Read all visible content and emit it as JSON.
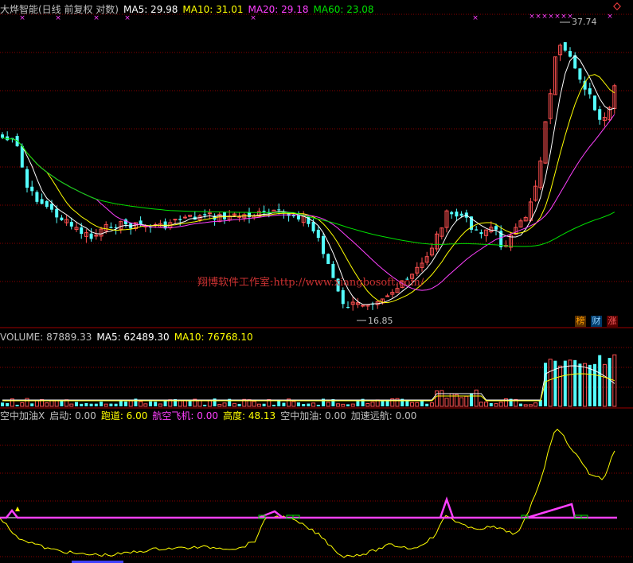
{
  "panel_main": {
    "name": "大烨智能(日线 前复权 对数)",
    "ma5": "MA5: 29.98",
    "ma10": "MA10: 31.01",
    "ma20": "MA20: 29.18",
    "ma60": "MA60: 23.08",
    "high_label": "37.74",
    "low_label": "16.85",
    "watermark": "翔博软件工作室:http://www.xiangbosoft.com/",
    "buttons": [
      "榜",
      "财",
      "涨"
    ]
  },
  "panel_volume": {
    "volume": "VOLUME: 87889.33",
    "ma5": "MA5: 62489.30",
    "ma10": "MA10: 76768.10"
  },
  "panel_indicator": {
    "name": "空中加油X",
    "start": "启动: 0.00",
    "runway": "跑道: 6.00",
    "airplane": "航空飞机: 0.00",
    "height": "高度: 48.13",
    "refuel": "空中加油: 0.00",
    "accel": "加速远航: 0.00"
  },
  "colors": {
    "up": "#ff5050",
    "down": "#54ffff",
    "ma5": "#ffffff",
    "ma10": "#ffff00",
    "ma20": "#ff40ff",
    "ma60": "#00e000",
    "grid": "#8b0000"
  },
  "chart_data": {
    "type": "candlestick",
    "price_high": 37.74,
    "price_low": 16.85,
    "current": {
      "ma5": 29.98,
      "ma10": 31.01,
      "ma20": 29.18,
      "ma60": 23.08,
      "volume": 87889.33,
      "vol_ma5": 62489.3,
      "vol_ma10": 76768.1
    },
    "indicator": {
      "start": 0.0,
      "runway": 6.0,
      "airplane": 0.0,
      "height": 48.13,
      "refuel": 0.0,
      "accel": 0.0
    }
  }
}
